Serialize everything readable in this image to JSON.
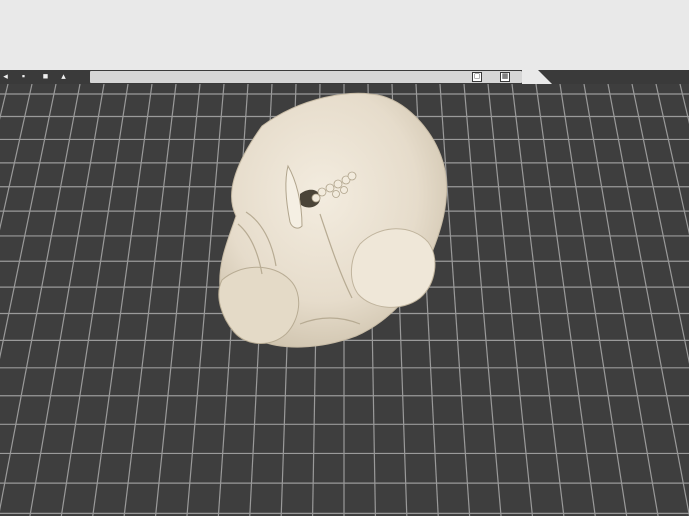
{
  "toolbar": {
    "buttons": [
      {
        "icon": "chevron-icon",
        "glyph": "◂"
      },
      {
        "icon": "camera-icon",
        "glyph": "▪"
      },
      {
        "icon": "square-icon",
        "glyph": "■"
      },
      {
        "icon": "printer-icon",
        "glyph": "▴"
      }
    ],
    "panel_label": "",
    "panel_right_text": "",
    "right_icons": [
      {
        "icon": "frame-icon",
        "glyph": "▢"
      },
      {
        "icon": "grid-icon",
        "glyph": "▦"
      }
    ]
  },
  "colors": {
    "bed": "#3e3e3e",
    "grid_line": "#9a9a9a",
    "model": "#e8e0d0",
    "model_shadow": "#b8ad98"
  }
}
